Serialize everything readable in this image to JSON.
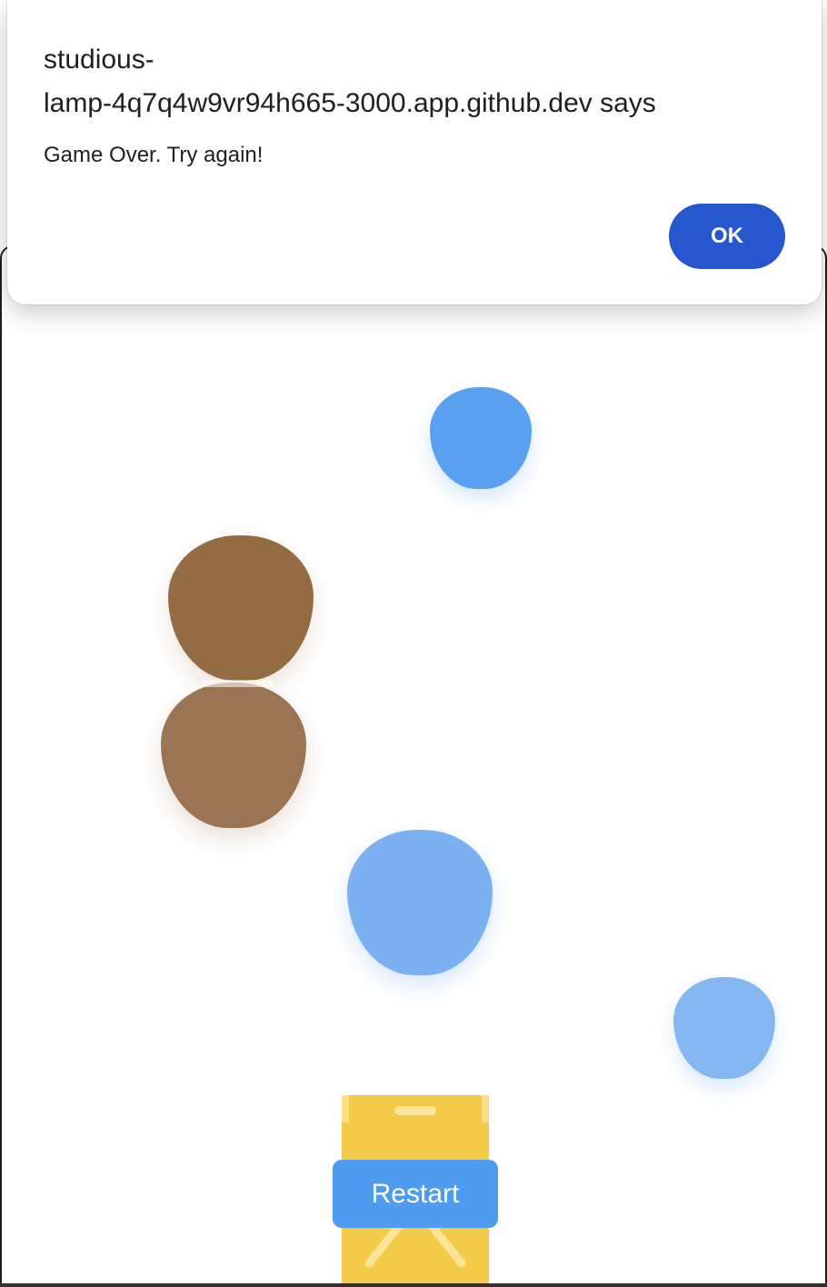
{
  "dialog": {
    "title": "studious-lamp-4q7q4w9vr94h665-3000.app.github.dev says",
    "message": "Game Over. Try again!",
    "ok_label": "OK",
    "ok_color": "#2757cf"
  },
  "game": {
    "restart_label": "Restart",
    "restart_color": "#4f9bef",
    "player_color": "#f3cb48",
    "drops": [
      {
        "name": "blue-drop",
        "color": "#5b9ff0"
      },
      {
        "name": "brown-drop",
        "color": "#946c43"
      },
      {
        "name": "brown-drop",
        "color": "#9b7453"
      },
      {
        "name": "blue-drop",
        "color": "#7bb1f1"
      },
      {
        "name": "blue-drop",
        "color": "#84b7f2"
      }
    ]
  }
}
